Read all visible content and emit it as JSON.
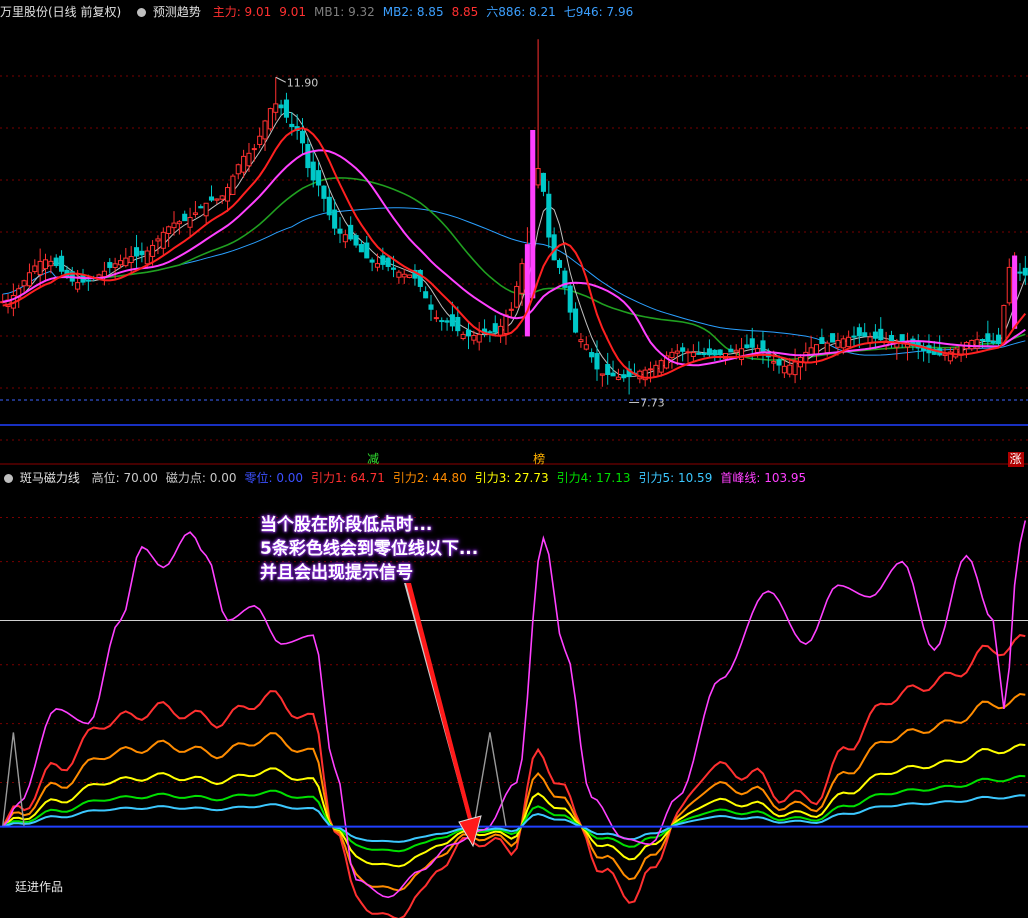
{
  "header": {
    "stock_title": "万里股份(日线 前复权)",
    "forecast_label": "预测趋势",
    "ma_legend": [
      {
        "label": "主力: 9.01",
        "color": "#ff3030"
      },
      {
        "label": "9.01",
        "color": "#ff3030"
      },
      {
        "label": "MB1: 9.32",
        "color": "#7f7f7f"
      },
      {
        "label": "MB2: 8.85",
        "color": "#3ca0ff"
      },
      {
        "label": "8.85",
        "color": "#ff3030"
      },
      {
        "label": "六886: 8.21",
        "color": "#3ca0ff"
      },
      {
        "label": "七946: 7.96",
        "color": "#3ca0ff"
      }
    ]
  },
  "indicator": {
    "name": "斑马磁力线",
    "legend": [
      {
        "label": "高位: 70.00",
        "color": "#c8c8c8"
      },
      {
        "label": "磁力点: 0.00",
        "color": "#c8c8c8"
      },
      {
        "label": "零位: 0.00",
        "color": "#3c50ff"
      },
      {
        "label": "引力1: 64.71",
        "color": "#ff3030"
      },
      {
        "label": "引力2: 44.80",
        "color": "#ff8c00"
      },
      {
        "label": "引力3: 27.73",
        "color": "#ffff00"
      },
      {
        "label": "引力4: 17.13",
        "color": "#00e000"
      },
      {
        "label": "引力5: 10.59",
        "color": "#3cc8ff"
      },
      {
        "label": "首峰线: 103.95",
        "color": "#ff40ff"
      }
    ]
  },
  "annotation": {
    "lines": [
      "当个股在阶段低点时...",
      "5条彩色线会到零位线以下...",
      "并且会出现提示信号"
    ]
  },
  "signals": [
    {
      "label": "减",
      "color": "#30e030",
      "x_index": 69
    },
    {
      "label": "榜",
      "color": "#ffb000",
      "x_index": 100
    },
    {
      "label": "涨",
      "color": "#ff4040",
      "x_index": 189
    }
  ],
  "footer": {
    "credit": "廷进作品"
  },
  "colors": {
    "up": "#ff3030",
    "down": "#00c8c8",
    "bg": "#000000"
  },
  "chart_data": [
    {
      "type": "candlestick",
      "title": "万里股份(日线 前复权)",
      "annotations": [
        {
          "label": "11.90",
          "type": "high"
        },
        {
          "label": "7.73",
          "type": "low"
        }
      ],
      "price_range": [
        7.0,
        12.6
      ],
      "high_value": 11.9,
      "low_value": 7.73,
      "n": 192
    },
    {
      "type": "line",
      "title": "斑马磁力线",
      "ylim": [
        -30,
        115
      ],
      "high_level": 70,
      "zero_level": 0,
      "series": [
        {
          "name": "引力1",
          "last": 64.71,
          "color": "#ff3030"
        },
        {
          "name": "引力2",
          "last": 44.8,
          "color": "#ff8c00"
        },
        {
          "name": "引力3",
          "last": 27.73,
          "color": "#ffff00"
        },
        {
          "name": "引力4",
          "last": 17.13,
          "color": "#00e000"
        },
        {
          "name": "引力5",
          "last": 10.59,
          "color": "#3cc8ff"
        },
        {
          "name": "首峰线",
          "last": 103.95,
          "color": "#ff40ff"
        }
      ]
    }
  ]
}
